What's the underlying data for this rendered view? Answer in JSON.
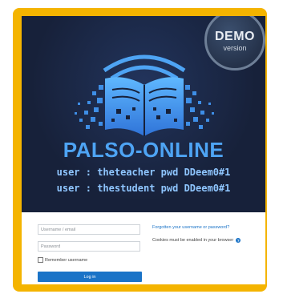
{
  "banner": {
    "demo_badge": {
      "title": "DEMO",
      "subtitle": "version"
    },
    "brand": "PALSO-ONLINE",
    "credentials": [
      "user : theteacher pwd DDeem0#1",
      "user : thestudent  pwd DDeem0#1"
    ],
    "icon": "open-book-pixel-icon",
    "colors": {
      "background": "#17213a",
      "brand": "#4ea4f4",
      "credentials": "#8fc6ff"
    }
  },
  "login": {
    "username_placeholder": "Username / email",
    "password_placeholder": "Password",
    "remember_label": "Remember username",
    "login_button": "Log in",
    "forgot_link": "Forgotten your username or password?",
    "cookies_notice": "Cookies must be enabled in your browser",
    "help_icon": "help-icon",
    "colors": {
      "button": "#1a73c7",
      "link": "#1a73c7"
    }
  },
  "frame_color": "#f4b400"
}
